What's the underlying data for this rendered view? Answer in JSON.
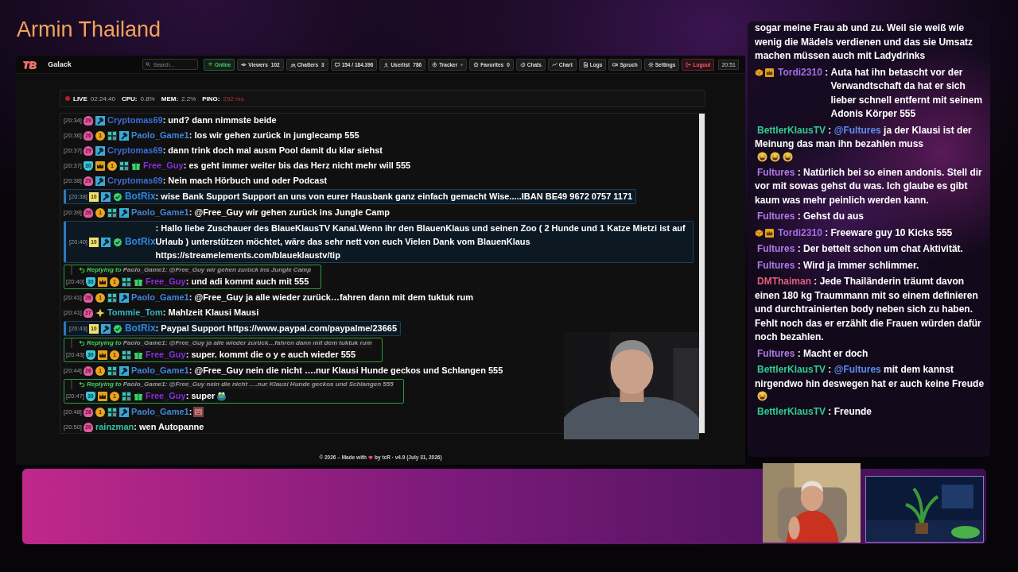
{
  "stream_title": "Armin Thailand",
  "app": {
    "logo": "TB",
    "name": "Galack",
    "search": {
      "placeholder": "Search..."
    },
    "buttons": [
      {
        "label": "Online",
        "kind": "online"
      },
      {
        "label": "Viewers",
        "count": "102",
        "kind": "nav"
      },
      {
        "label": "Chatters",
        "count": "3",
        "kind": "nav"
      },
      {
        "label": "154 / 184.396",
        "kind": "nav"
      },
      {
        "label": "Userlist",
        "count": "786",
        "kind": "nav"
      },
      {
        "label": "Tracker",
        "kind": "tracker"
      },
      {
        "label": "Favorites",
        "count": "0",
        "kind": "nav"
      },
      {
        "label": "Chats",
        "kind": "nav"
      },
      {
        "label": "Chart",
        "kind": "nav"
      },
      {
        "label": "Logs",
        "kind": "nav"
      },
      {
        "label": "Spruch",
        "kind": "nav"
      },
      {
        "label": "Settings",
        "kind": "nav"
      },
      {
        "label": "Logout",
        "kind": "danger"
      }
    ],
    "clock": "20:51"
  },
  "status": [
    {
      "label": "LIVE",
      "value": "02:24:40",
      "kind": "live"
    },
    {
      "label": "CPU:",
      "value": "0.8%",
      "kind": "stat"
    },
    {
      "label": "MEM:",
      "value": "2.2%",
      "kind": "stat"
    },
    {
      "label": "PING:",
      "value": "292 ms",
      "kind": "alert"
    }
  ],
  "chat": {
    "messages": [
      {
        "kind": "message",
        "time": "[20:34]",
        "badges": [
          {
            "kind": "sub",
            "label": "29"
          },
          {
            "kind": "mod"
          }
        ],
        "user": "Cryptomas69",
        "color": "#3a6fd8",
        "sep": ": ",
        "text": "und? dann nimmste beide"
      },
      {
        "kind": "message",
        "time": "[20:36]",
        "badges": [
          {
            "kind": "sub",
            "label": "26"
          },
          {
            "kind": "coin",
            "label": "1"
          },
          {
            "kind": "grid"
          },
          {
            "kind": "mod"
          }
        ],
        "user": "Paolo_Game1",
        "color": "#3f86d8",
        "sep": ": ",
        "text": "los wir gehen zurück in junglecamp 555"
      },
      {
        "kind": "message",
        "time": "[20:37]",
        "badges": [
          {
            "kind": "sub",
            "label": "29"
          },
          {
            "kind": "mod"
          }
        ],
        "user": "Cryptomas69",
        "color": "#3a6fd8",
        "sep": ": ",
        "text": "dann trink doch mal ausm Pool damit du klar siehst"
      },
      {
        "kind": "message",
        "time": "[20:37]",
        "badges": [
          {
            "kind": "shield",
            "label": "30"
          },
          {
            "kind": "crown"
          },
          {
            "kind": "coin",
            "label": "1"
          },
          {
            "kind": "grid"
          },
          {
            "kind": "gift"
          }
        ],
        "user": "Free_Guy",
        "color": "#8a2be2",
        "sep": ": ",
        "text": "es geht immer weiter bis das Herz nicht mehr will 555"
      },
      {
        "kind": "message",
        "time": "[20:38]",
        "badges": [
          {
            "kind": "sub",
            "label": "29"
          },
          {
            "kind": "mod"
          }
        ],
        "user": "Cryptomas69",
        "color": "#3a6fd8",
        "sep": ": ",
        "text": "Nein mach Hörbuch und oder Podcast"
      },
      {
        "kind": "highlight",
        "time": "[20:38]",
        "badges": [
          {
            "kind": "level",
            "label": "10"
          },
          {
            "kind": "mod"
          },
          {
            "kind": "verified"
          }
        ],
        "user": "BotRix",
        "color": "#2e86de",
        "sep": ": ",
        "text": "wise Bank Support Support an uns von eurer Hausbank ganz einfach gemacht Wise.....IBAN BE49 9672 0757 1171"
      },
      {
        "kind": "message",
        "time": "[20:39]",
        "badges": [
          {
            "kind": "sub",
            "label": "26"
          },
          {
            "kind": "coin",
            "label": "1"
          },
          {
            "kind": "grid"
          },
          {
            "kind": "mod"
          }
        ],
        "user": "Paolo_Game1",
        "color": "#3f86d8",
        "sep": ": ",
        "text": "@Free_Guy wir gehen zurück ins Jungle Camp"
      },
      {
        "kind": "highlight",
        "time": "[20:40]",
        "badges": [
          {
            "kind": "level",
            "label": "10"
          },
          {
            "kind": "mod"
          },
          {
            "kind": "verified"
          }
        ],
        "user": "BotRix",
        "color": "#2e86de",
        "sep": ": ",
        "text": "Hallo liebe Zuschauer des BlaueKlausTV Kanal.Wenn ihr den BlauenKlaus und seinen Zoo ( 2 Hunde und 1 Katze Mietzi ist auf Urlaub ) unterstützen möchtet, wäre das sehr nett von euch Vielen Dank vom BlauenKlaus https://streamelements.com/blaueklaustv/tip"
      },
      {
        "kind": "reply",
        "reply": {
          "label": "Replying to",
          "text": "Paolo_Game1: @Free_Guy wir gehen zurück ins Jungle Camp"
        },
        "time": "[20:40]",
        "badges": [
          {
            "kind": "shield",
            "label": "30"
          },
          {
            "kind": "crown"
          },
          {
            "kind": "coin",
            "label": "1"
          },
          {
            "kind": "grid"
          },
          {
            "kind": "gift"
          }
        ],
        "user": "Free_Guy",
        "color": "#8a2be2",
        "sep": ": ",
        "text": "und adi kommt auch mit 555"
      },
      {
        "kind": "message",
        "time": "[20:41]",
        "badges": [
          {
            "kind": "sub",
            "label": "26"
          },
          {
            "kind": "coin",
            "label": "1"
          },
          {
            "kind": "grid"
          },
          {
            "kind": "mod"
          }
        ],
        "user": "Paolo_Game1",
        "color": "#3f86d8",
        "sep": ": ",
        "text": "@Free_Guy ja alle wieder zurück…fahren dann mit dem tuktuk rum"
      },
      {
        "kind": "message",
        "time": "[20:41]",
        "badges": [
          {
            "kind": "sub",
            "label": "27"
          },
          {
            "kind": "star"
          }
        ],
        "user": "Tommie_Tom",
        "color": "#38b2c8",
        "sep": ": ",
        "text": "Mahlzeit Klausi Mausi"
      },
      {
        "kind": "highlight",
        "time": "[20:43]",
        "badges": [
          {
            "kind": "level",
            "label": "10"
          },
          {
            "kind": "mod"
          },
          {
            "kind": "verified"
          }
        ],
        "user": "BotRix",
        "color": "#2e86de",
        "sep": ": ",
        "text": "Paypal Support https://www.paypal.com/paypalme/23665"
      },
      {
        "kind": "reply",
        "reply": {
          "label": "Replying to",
          "text": "Paolo_Game1: @Free_Guy ja alle wieder zurück…fahren dann mit dem tuktuk rum"
        },
        "time": "[20:43]",
        "badges": [
          {
            "kind": "shield",
            "label": "30"
          },
          {
            "kind": "crown"
          },
          {
            "kind": "coin",
            "label": "1"
          },
          {
            "kind": "grid"
          },
          {
            "kind": "gift"
          }
        ],
        "user": "Free_Guy",
        "color": "#8a2be2",
        "sep": ": ",
        "text": "super. kommt die o y e auch wieder 555"
      },
      {
        "kind": "message",
        "time": "[20:44]",
        "badges": [
          {
            "kind": "sub",
            "label": "26"
          },
          {
            "kind": "coin",
            "label": "1"
          },
          {
            "kind": "grid"
          },
          {
            "kind": "mod"
          }
        ],
        "user": "Paolo_Game1",
        "color": "#3f86d8",
        "sep": ": ",
        "text": "@Free_Guy nein die nicht ….nur Klausi Hunde geckos und Schlangen 555"
      },
      {
        "kind": "reply",
        "reply": {
          "label": "Replying to",
          "text": "Paolo_Game1: @Free_Guy nein die nicht ….nur Klausi Hunde geckos und Schlangen 555"
        },
        "time": "[20:47]",
        "badges": [
          {
            "kind": "shield",
            "label": "30"
          },
          {
            "kind": "crown"
          },
          {
            "kind": "coin",
            "label": "1"
          },
          {
            "kind": "grid"
          },
          {
            "kind": "gift"
          }
        ],
        "user": "Free_Guy",
        "color": "#8a2be2",
        "sep": ": ",
        "text": "super",
        "emotes": [
          {
            "kind": "frog"
          }
        ]
      },
      {
        "kind": "message",
        "time": "[20:48]",
        "badges": [
          {
            "kind": "sub",
            "label": "26"
          },
          {
            "kind": "coin",
            "label": "1"
          },
          {
            "kind": "grid"
          },
          {
            "kind": "mod"
          }
        ],
        "user": "Paolo_Game1",
        "color": "#3f86d8",
        "sep": ":",
        "emotes": [
          {
            "kind": "sticker"
          }
        ]
      },
      {
        "kind": "message",
        "time": "[20:50]",
        "badges": [
          {
            "kind": "sub",
            "label": "20"
          }
        ],
        "user": "rainzman",
        "color": "#2ec4a4",
        "sep": ": ",
        "text": "wen Autopanne"
      }
    ]
  },
  "footer": {
    "before": "© 2026 – Made with",
    "after": "by tcR · v4.9 (July 31, 2026)"
  },
  "overlay_chat": [
    {
      "text": "sogar meine Frau ab und zu. Weil sie weiß wie wenig die Mädels verdienen und das sie Umsatz machen müssen auch mit Ladydrinks"
    },
    {
      "user": "Tordi2310",
      "color": "#a56de2",
      "badges": [
        {
          "kind": "cube"
        },
        {
          "kind": "crown"
        }
      ],
      "sep": " : ",
      "text": "Auta hat ihn betascht vor der Verwandtschaft da hat er sich lieber schnell entfernt mit seinem Adonis Körper 555"
    },
    {
      "user": "BettlerKlausTV",
      "color": "#2ecc8f",
      "sep": " : ",
      "mention": "@Fultures",
      "text": "ja der Klausi ist der Meinung das man ihn bezahlen muss",
      "emotes": [
        {
          "kind": "laugh"
        },
        {
          "kind": "laugh"
        },
        {
          "kind": "laugh"
        }
      ]
    },
    {
      "user": "Fultures",
      "color": "#b07ae8",
      "sep": " : ",
      "text": "Natürlich bei so einen andonis. Stell dir vor mit sowas gehst du was. Ich glaube es gibt kaum was mehr peinlich werden kann."
    },
    {
      "user": "Fultures",
      "color": "#b07ae8",
      "sep": " : ",
      "text": "Gehst du aus"
    },
    {
      "user": "Tordi2310",
      "color": "#a56de2",
      "badges": [
        {
          "kind": "cube"
        },
        {
          "kind": "crown"
        }
      ],
      "sep": " : ",
      "text": "Freeware guy 10 Kicks 555"
    },
    {
      "user": "Fultures",
      "color": "#b07ae8",
      "sep": " : ",
      "text": "Der bettelt schon um chat Aktivität."
    },
    {
      "user": "Fultures",
      "color": "#b07ae8",
      "sep": " : ",
      "text": "Wird ja immer schlimmer."
    },
    {
      "user": "DMThaiman",
      "color": "#e0607a",
      "sep": " : ",
      "text": "Jede Thailänderin träumt davon einen 180 kg Traummann mit so einem definieren und durchtrainierten body neben sich zu haben. Fehlt noch das er erzählt die Frauen würden dafür noch bezahlen."
    },
    {
      "user": "Fultures",
      "color": "#b07ae8",
      "sep": " : ",
      "text": "Macht er doch"
    },
    {
      "user": "BettlerKlausTV",
      "color": "#2ecc8f",
      "sep": " : ",
      "mention": "@Fultures",
      "text": "mit dem kannst nirgendwo hin deswegen hat er auch keine Freude",
      "emotes": [
        {
          "kind": "laugh"
        }
      ]
    },
    {
      "user": "BettlerKlausTV",
      "color": "#2ecc8f",
      "sep": " : ",
      "text": "Freunde"
    }
  ]
}
